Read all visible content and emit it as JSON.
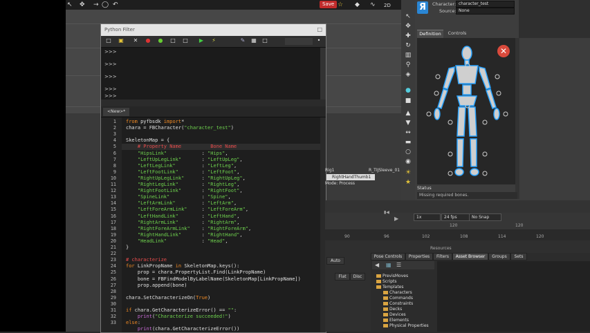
{
  "toolbar": {
    "save_label": "Save",
    "zoom_label": "2D"
  },
  "python_filter": {
    "title": "Python Filter",
    "console_prompts": [
      ">>>",
      ">>>",
      ">>>",
      ">>>",
      ">>>"
    ],
    "tab_label": "<New>*"
  },
  "code": {
    "line_numbers": [
      "1",
      "2",
      "3",
      "4",
      "5",
      "6",
      "7",
      "8",
      "9",
      "10",
      "11",
      "12",
      "13",
      "14",
      "15",
      "16",
      "17",
      "18",
      "19",
      "20",
      "21",
      "22",
      "23",
      "24",
      "25",
      "26",
      "27",
      "28",
      "29",
      "30",
      "31",
      "32",
      "33"
    ]
  },
  "character_panel": {
    "character_label": "Character:",
    "character_value": "character_test",
    "source_label": "Source:",
    "source_value": "None",
    "tab_definition": "Definition",
    "tab_controls": "Controls",
    "status_label": "Status",
    "status_message": "Missing required bones."
  },
  "timeline": {
    "labels": [
      "Rig1",
      "R_TIJSleeve_01",
      "RightHandThumb1",
      "Mode: Process"
    ],
    "speed": "1x",
    "fps": "24 fps",
    "snap": "No Snap",
    "frame_a": "120",
    "frame_b": "120",
    "ticks": [
      "90",
      "96",
      "102",
      "108",
      "114",
      "120"
    ]
  },
  "resources": {
    "title": "Resources",
    "tabs": [
      "Pose Controls",
      "Properties",
      "Filters",
      "Asset Browser",
      "Groups",
      "Sets"
    ],
    "active_tab": "Asset Browser",
    "tree": [
      "PrevisMoves",
      "Scripts",
      "Templates",
      "Characters",
      "Commands",
      "Constraints",
      "Decks",
      "Devices",
      "Elements",
      "Physical Properties"
    ]
  },
  "mini_controls": {
    "auto_label": "Auto",
    "flat_label": "Flat",
    "disc_label": "Disc"
  },
  "colors": {
    "accent": "#2a86d4",
    "save": "#c12b2b",
    "keyword": "#f08a24",
    "string": "#6fd34e",
    "comment": "#e74c4c",
    "builtin": "#c76ad6"
  }
}
